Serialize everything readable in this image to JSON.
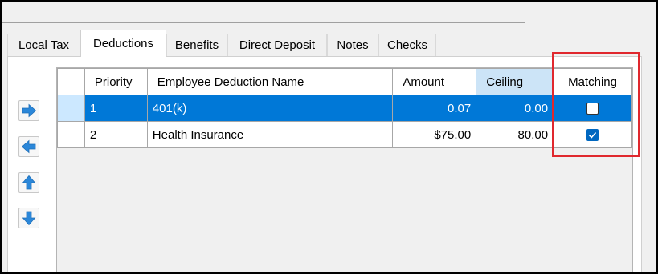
{
  "tabs": [
    {
      "label": "Local Tax"
    },
    {
      "label": "Deductions"
    },
    {
      "label": "Benefits"
    },
    {
      "label": "Direct Deposit"
    },
    {
      "label": "Notes"
    },
    {
      "label": "Checks"
    }
  ],
  "active_tab": "Deductions",
  "nav_buttons": [
    "right-arrow-icon",
    "left-arrow-icon",
    "up-arrow-icon",
    "down-arrow-icon"
  ],
  "grid": {
    "columns": [
      {
        "label": "Priority"
      },
      {
        "label": "Employee Deduction Name"
      },
      {
        "label": "Amount"
      },
      {
        "label": "Ceiling"
      },
      {
        "label": "Matching"
      }
    ],
    "rows": [
      {
        "priority": "1",
        "name": "401(k)",
        "amount": "0.07",
        "ceiling": "0.00",
        "matching": false,
        "selected": true
      },
      {
        "priority": "2",
        "name": "Health Insurance",
        "amount": "$75.00",
        "ceiling": "80.00",
        "matching": true,
        "selected": false
      }
    ]
  },
  "colors": {
    "selection": "#0078d7",
    "highlight_box": "#e0282e",
    "arrow_icon": "#2b87d9",
    "checkbox_checked": "#0067c0"
  }
}
